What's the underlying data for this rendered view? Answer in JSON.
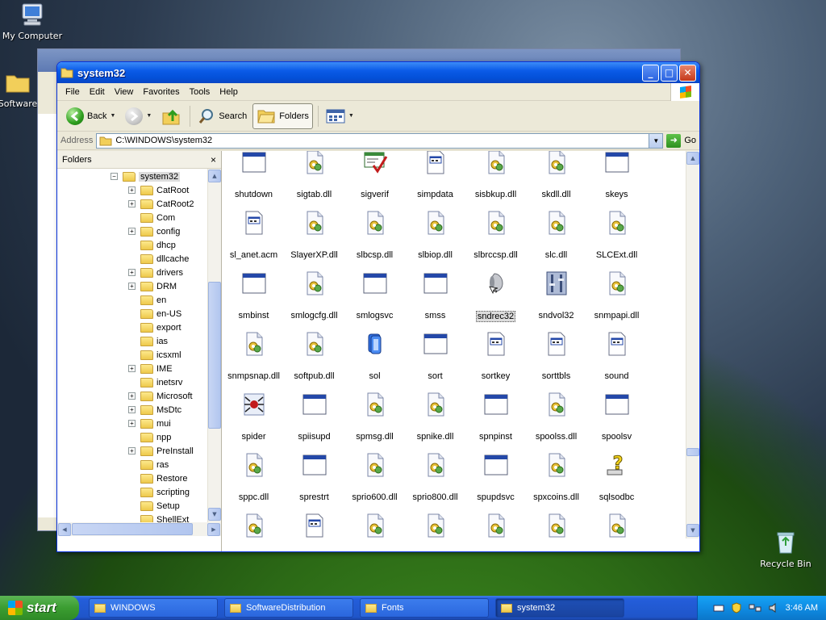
{
  "desktop": {
    "icons": [
      {
        "label": "My Computer"
      },
      {
        "label": "Software"
      },
      {
        "label": "Recycle Bin"
      }
    ]
  },
  "window": {
    "title": "system32",
    "menu": [
      "File",
      "Edit",
      "View",
      "Favorites",
      "Tools",
      "Help"
    ],
    "toolbar": {
      "back": "Back",
      "search": "Search",
      "folders": "Folders"
    },
    "address": {
      "label": "Address",
      "value": "C:\\WINDOWS\\system32",
      "go": "Go"
    },
    "folders_pane": {
      "title": "Folders",
      "close": "×"
    },
    "tree": [
      {
        "label": "system32",
        "exp": "minus"
      },
      {
        "label": "CatRoot",
        "exp": "plus"
      },
      {
        "label": "CatRoot2",
        "exp": "plus"
      },
      {
        "label": "Com",
        "exp": "none"
      },
      {
        "label": "config",
        "exp": "plus"
      },
      {
        "label": "dhcp",
        "exp": "none"
      },
      {
        "label": "dllcache",
        "exp": "none"
      },
      {
        "label": "drivers",
        "exp": "plus"
      },
      {
        "label": "DRM",
        "exp": "plus"
      },
      {
        "label": "en",
        "exp": "none"
      },
      {
        "label": "en-US",
        "exp": "none"
      },
      {
        "label": "export",
        "exp": "none"
      },
      {
        "label": "ias",
        "exp": "none"
      },
      {
        "label": "icsxml",
        "exp": "none"
      },
      {
        "label": "IME",
        "exp": "plus"
      },
      {
        "label": "inetsrv",
        "exp": "none"
      },
      {
        "label": "Microsoft",
        "exp": "plus"
      },
      {
        "label": "MsDtc",
        "exp": "plus"
      },
      {
        "label": "mui",
        "exp": "plus"
      },
      {
        "label": "npp",
        "exp": "none"
      },
      {
        "label": "PreInstall",
        "exp": "plus"
      },
      {
        "label": "ras",
        "exp": "none"
      },
      {
        "label": "Restore",
        "exp": "none"
      },
      {
        "label": "scripting",
        "exp": "none"
      },
      {
        "label": "Setup",
        "exp": "none"
      },
      {
        "label": "ShellExt",
        "exp": "none"
      }
    ],
    "files": [
      {
        "name": "shutdown",
        "icon": "exe"
      },
      {
        "name": "sigtab.dll",
        "icon": "dll"
      },
      {
        "name": "sigverif",
        "icon": "sigverif"
      },
      {
        "name": "simpdata",
        "icon": "data"
      },
      {
        "name": "sisbkup.dll",
        "icon": "dll"
      },
      {
        "name": "skdll.dll",
        "icon": "dll"
      },
      {
        "name": "skeys",
        "icon": "exe"
      },
      {
        "name": "sl_anet.acm",
        "icon": "data"
      },
      {
        "name": "SlayerXP.dll",
        "icon": "dll"
      },
      {
        "name": "slbcsp.dll",
        "icon": "dll"
      },
      {
        "name": "slbiop.dll",
        "icon": "dll"
      },
      {
        "name": "slbrccsp.dll",
        "icon": "dll"
      },
      {
        "name": "slc.dll",
        "icon": "dll"
      },
      {
        "name": "SLCExt.dll",
        "icon": "dll"
      },
      {
        "name": "smbinst",
        "icon": "exe"
      },
      {
        "name": "smlogcfg.dll",
        "icon": "dll"
      },
      {
        "name": "smlogsvc",
        "icon": "exe"
      },
      {
        "name": "smss",
        "icon": "exe"
      },
      {
        "name": "sndrec32",
        "icon": "speaker"
      },
      {
        "name": "sndvol32",
        "icon": "volume"
      },
      {
        "name": "snmpapi.dll",
        "icon": "dll"
      },
      {
        "name": "snmpsnap.dll",
        "icon": "dll"
      },
      {
        "name": "softpub.dll",
        "icon": "dll"
      },
      {
        "name": "sol",
        "icon": "cards"
      },
      {
        "name": "sort",
        "icon": "exe"
      },
      {
        "name": "sortkey",
        "icon": "data"
      },
      {
        "name": "sorttbls",
        "icon": "data"
      },
      {
        "name": "sound",
        "icon": "data"
      },
      {
        "name": "spider",
        "icon": "spider"
      },
      {
        "name": "spiisupd",
        "icon": "exe"
      },
      {
        "name": "spmsg.dll",
        "icon": "dll"
      },
      {
        "name": "spnike.dll",
        "icon": "dll"
      },
      {
        "name": "spnpinst",
        "icon": "exe"
      },
      {
        "name": "spoolss.dll",
        "icon": "dll"
      },
      {
        "name": "spoolsv",
        "icon": "exe"
      },
      {
        "name": "sppc.dll",
        "icon": "dll"
      },
      {
        "name": "sprestrt",
        "icon": "exe"
      },
      {
        "name": "sprio600.dll",
        "icon": "dll"
      },
      {
        "name": "sprio800.dll",
        "icon": "dll"
      },
      {
        "name": "spupdsvc",
        "icon": "exe"
      },
      {
        "name": "spxcoins.dll",
        "icon": "dll"
      },
      {
        "name": "sqlsodbc",
        "icon": "help"
      },
      {
        "name": "",
        "icon": "dll"
      },
      {
        "name": "",
        "icon": "data"
      },
      {
        "name": "",
        "icon": "dll"
      },
      {
        "name": "",
        "icon": "dll"
      },
      {
        "name": "",
        "icon": "dll"
      },
      {
        "name": "",
        "icon": "dll"
      },
      {
        "name": "",
        "icon": "dll"
      }
    ],
    "selected_file": "sndrec32"
  },
  "taskbar": {
    "start": "start",
    "tasks": [
      {
        "label": "WINDOWS"
      },
      {
        "label": "SoftwareDistribution"
      },
      {
        "label": "Fonts"
      },
      {
        "label": "system32",
        "active": true
      }
    ],
    "clock": "3:46 AM"
  }
}
